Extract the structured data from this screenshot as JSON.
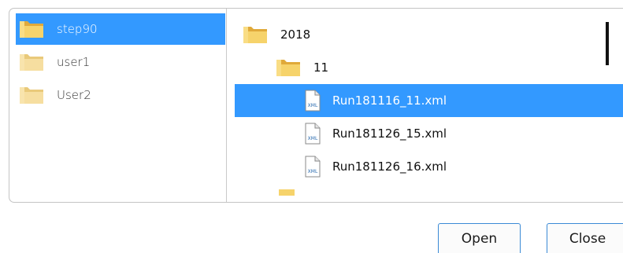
{
  "users": [
    {
      "label": "step90",
      "selected": true,
      "icon": "folder-icon"
    },
    {
      "label": "user1",
      "selected": false,
      "icon": "folder-icon"
    },
    {
      "label": "User2",
      "selected": false,
      "icon": "folder-icon"
    }
  ],
  "tree": [
    {
      "label": "2018",
      "type": "folder",
      "selected": false
    },
    {
      "label": "11",
      "type": "folder",
      "selected": false
    },
    {
      "label": "Run181116_11.xml",
      "type": "xml-file",
      "selected": true
    },
    {
      "label": "Run181126_15.xml",
      "type": "xml-file",
      "selected": false
    },
    {
      "label": "Run181126_16.xml",
      "type": "xml-file",
      "selected": false
    }
  ],
  "xml_icon_text": "XML",
  "buttons": {
    "open": "Open",
    "close": "Close"
  },
  "colors": {
    "selection": "#3399ff",
    "folder": "#f2c94c",
    "border": "#c4c4c4"
  }
}
